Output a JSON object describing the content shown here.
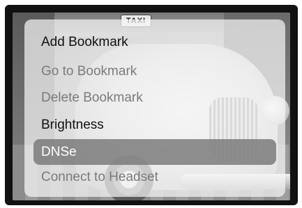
{
  "background_photo": {
    "sign_text": "TAXI"
  },
  "menu": {
    "items": [
      {
        "label": "Add Bookmark",
        "state": "enabled"
      },
      {
        "label": "Go to Bookmark",
        "state": "disabled"
      },
      {
        "label": "Delete Bookmark",
        "state": "disabled"
      },
      {
        "label": "Brightness",
        "state": "enabled"
      },
      {
        "label": "DNSe",
        "state": "selected"
      },
      {
        "label": "Connect to Headset",
        "state": "disabled"
      }
    ]
  }
}
